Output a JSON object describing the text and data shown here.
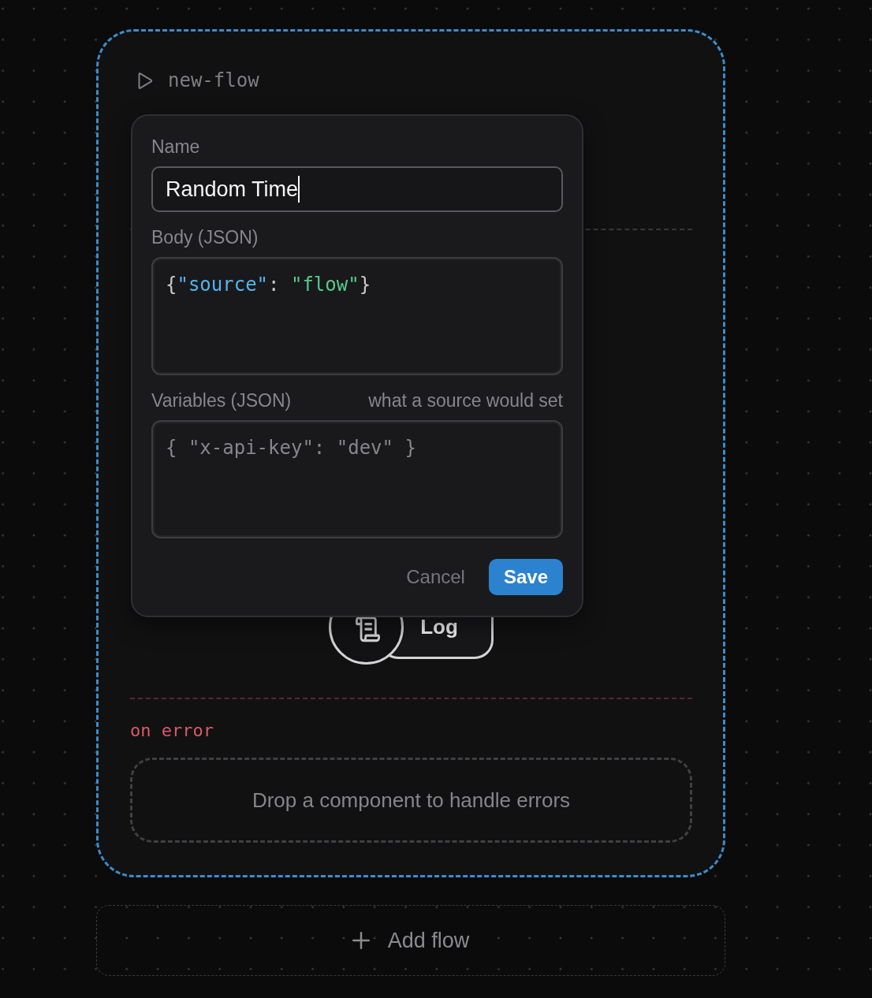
{
  "flow": {
    "name": "new-flow",
    "selected": true,
    "steps": [
      {
        "kind": "log",
        "label": "Log"
      }
    ],
    "error_section": {
      "label": "on error",
      "placeholder": "Drop a component to handle errors"
    }
  },
  "editor": {
    "fields": [
      {
        "kind": "text",
        "label": "Name",
        "value": "Random Time",
        "focused": true
      },
      {
        "kind": "code",
        "label": "Body (JSON)",
        "value": "{\"source\": \"flow\"}",
        "focused": false
      },
      {
        "kind": "code",
        "label": "Variables (JSON)",
        "hint": "what a source would set",
        "placeholder": "{ \"x-api-key\": \"dev\" }",
        "focused": false
      }
    ],
    "buttons": [
      {
        "kind": "secondary",
        "label": "Cancel"
      },
      {
        "kind": "primary",
        "label": "Save"
      }
    ]
  },
  "add_flow": {
    "label": "Add flow"
  }
}
